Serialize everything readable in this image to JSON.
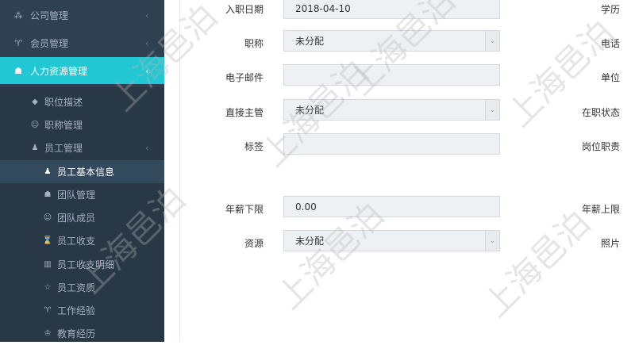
{
  "sidebar": {
    "top_items": [
      {
        "label": "公司管理",
        "icon": "sitemap-icon",
        "chevron": "‹"
      },
      {
        "label": "会员管理",
        "icon": "trophy-icon",
        "chevron": "‹"
      },
      {
        "label": "人力资源管理",
        "icon": "users-icon",
        "chevron": "‹"
      }
    ],
    "sub_items": [
      {
        "label": "职位描述",
        "icon": "diamond-icon"
      },
      {
        "label": "职称管理",
        "icon": "group-icon"
      },
      {
        "label": "员工管理",
        "icon": "user-icon",
        "chevron": "‹"
      },
      {
        "label": "员工基本信息",
        "icon": "user-icon"
      },
      {
        "label": "团队管理",
        "icon": "team-icon"
      },
      {
        "label": "团队成员",
        "icon": "person-icon"
      },
      {
        "label": "员工收支",
        "icon": "hourglass-icon"
      },
      {
        "label": "员工收支明细",
        "icon": "map-icon"
      },
      {
        "label": "员工资质",
        "icon": "star-icon"
      },
      {
        "label": "工作经验",
        "icon": "trophy-icon"
      },
      {
        "label": "教育经历",
        "icon": "graduation-cap-icon"
      }
    ]
  },
  "form": {
    "hire_date": {
      "label": "入职日期",
      "value": "2018-04-10"
    },
    "title": {
      "label": "职称",
      "value": "未分配"
    },
    "email": {
      "label": "电子邮件",
      "value": ""
    },
    "supervisor": {
      "label": "直接主管",
      "value": "未分配"
    },
    "tags": {
      "label": "标签",
      "value": ""
    },
    "salary_min": {
      "label": "年薪下限",
      "value": "0.00"
    },
    "source": {
      "label": "资源",
      "value": "未分配"
    }
  },
  "right_labels": {
    "education": "学历",
    "phone": "电话",
    "unit": "单位",
    "employment_status": "在职状态",
    "job_duties": "岗位职责",
    "salary_max": "年薪上限",
    "photo": "照片"
  },
  "watermark": "上海邑泊",
  "colors": {
    "sidebar_bg": "#2f4050",
    "accent": "#22c7d4",
    "submenu_bg": "#293846"
  }
}
